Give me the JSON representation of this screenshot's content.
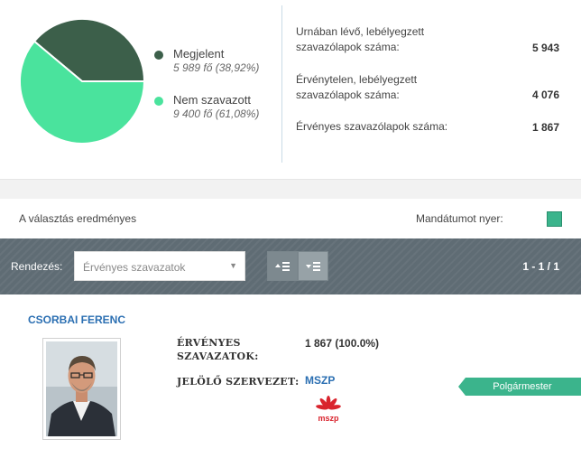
{
  "turnout": {
    "chart_data": {
      "type": "pie",
      "slices": [
        {
          "name": "Megjelent",
          "value": 38.92,
          "color": "#3c5f4a"
        },
        {
          "name": "Nem szavazott",
          "value": 61.08,
          "color": "#4ae39d"
        }
      ]
    },
    "legend": [
      {
        "label": "Megjelent",
        "value": "5 989 fő (38,92%)",
        "color": "#3c5f4a"
      },
      {
        "label": "Nem szavazott",
        "value": "9 400 fő (61,08%)",
        "color": "#4ae39d"
      }
    ]
  },
  "stats": [
    {
      "label": "Urnában lévő, lebélyegzett szavazólapok száma:",
      "value": "5 943"
    },
    {
      "label": "Érvénytelen, lebélyegzett szavazólapok száma:",
      "value": "4 076"
    },
    {
      "label": "Érvényes szavazólapok száma:",
      "value": "1 867"
    }
  ],
  "result": {
    "text": "A választás eredményes",
    "mandate_label": "Mandátumot nyer:",
    "mandate_color": "#3bb48c"
  },
  "toolbar": {
    "sort_label": "Rendezés:",
    "sort_selected": "Érvényes szavazatok",
    "sort_asc_icon": "sort-ascending-icon",
    "sort_desc_icon": "sort-descending-icon",
    "pager": "1 - 1 / 1"
  },
  "candidate": {
    "name": "CSORBAI FERENC",
    "valid_votes_label": "ÉRVÉNYES SZAVAZATOK:",
    "valid_votes_value": "1 867 (100.0%)",
    "org_label": "JELÖLŐ SZERVEZET:",
    "org_value": "MSZP",
    "logo_text": "mszp",
    "role": "Polgármester"
  }
}
